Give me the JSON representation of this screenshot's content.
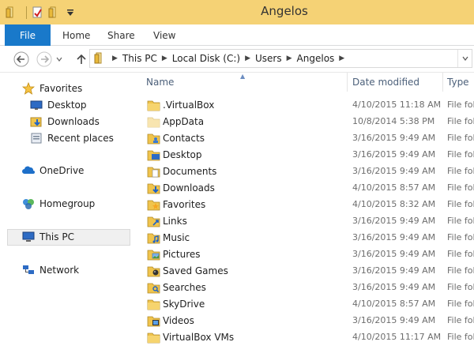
{
  "window": {
    "title": "Angelos"
  },
  "ribbon": {
    "tabs": [
      "File",
      "Home",
      "Share",
      "View"
    ]
  },
  "address": {
    "crumbs": [
      "This PC",
      "Local Disk (C:)",
      "Users",
      "Angelos"
    ]
  },
  "nav": {
    "favorites": "Favorites",
    "desktop": "Desktop",
    "downloads": "Downloads",
    "recent": "Recent places",
    "onedrive": "OneDrive",
    "homegroup": "Homegroup",
    "thispc": "This PC",
    "network": "Network"
  },
  "columns": {
    "name": "Name",
    "date": "Date modified",
    "type": "Type"
  },
  "files": [
    {
      "name": ".VirtualBox",
      "date": "4/10/2015 11:18 AM",
      "type": "File folder",
      "icon": "folder"
    },
    {
      "name": "AppData",
      "date": "10/8/2014 5:38 PM",
      "type": "File folder",
      "icon": "folder-hidden"
    },
    {
      "name": "Contacts",
      "date": "3/16/2015 9:49 AM",
      "type": "File folder",
      "icon": "contacts"
    },
    {
      "name": "Desktop",
      "date": "3/16/2015 9:49 AM",
      "type": "File folder",
      "icon": "desktop"
    },
    {
      "name": "Documents",
      "date": "3/16/2015 9:49 AM",
      "type": "File folder",
      "icon": "documents"
    },
    {
      "name": "Downloads",
      "date": "4/10/2015 8:57 AM",
      "type": "File folder",
      "icon": "downloads"
    },
    {
      "name": "Favorites",
      "date": "4/10/2015 8:32 AM",
      "type": "File folder",
      "icon": "favorites"
    },
    {
      "name": "Links",
      "date": "3/16/2015 9:49 AM",
      "type": "File folder",
      "icon": "links"
    },
    {
      "name": "Music",
      "date": "3/16/2015 9:49 AM",
      "type": "File folder",
      "icon": "music"
    },
    {
      "name": "Pictures",
      "date": "3/16/2015 9:49 AM",
      "type": "File folder",
      "icon": "pictures"
    },
    {
      "name": "Saved Games",
      "date": "3/16/2015 9:49 AM",
      "type": "File folder",
      "icon": "saved-games"
    },
    {
      "name": "Searches",
      "date": "3/16/2015 9:49 AM",
      "type": "File folder",
      "icon": "searches"
    },
    {
      "name": "SkyDrive",
      "date": "4/10/2015 8:57 AM",
      "type": "File folder",
      "icon": "folder"
    },
    {
      "name": "Videos",
      "date": "3/16/2015 9:49 AM",
      "type": "File folder",
      "icon": "videos"
    },
    {
      "name": "VirtualBox VMs",
      "date": "4/10/2015 11:17 AM",
      "type": "File folder",
      "icon": "folder"
    }
  ],
  "colors": {
    "titlebar": "#f5d275",
    "file_tab": "#1979ca",
    "folder": "#f0c44c"
  }
}
